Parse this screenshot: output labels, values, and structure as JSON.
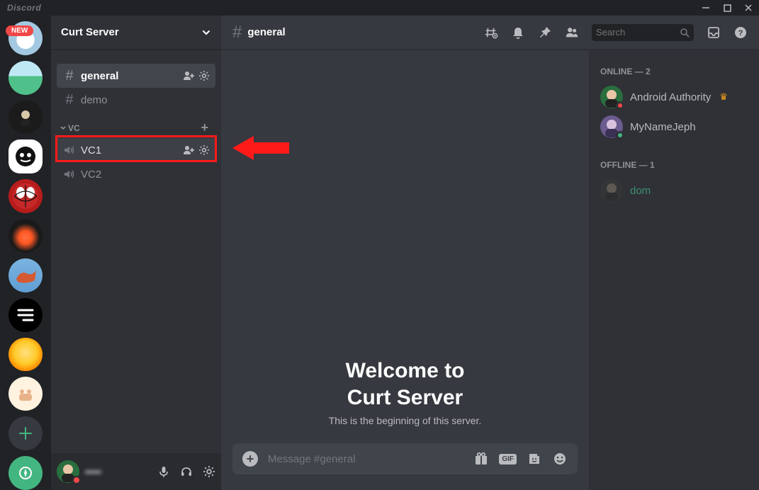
{
  "app": {
    "title": "Discord",
    "new_badge": "NEW"
  },
  "titlebar": {
    "minimize": "—",
    "maximize": "▢",
    "close": "✕"
  },
  "server": {
    "name": "Curt Server",
    "chevron": "˅"
  },
  "channels": {
    "text": [
      {
        "name": "general",
        "selected": true
      },
      {
        "name": "demo",
        "selected": false
      }
    ],
    "category": {
      "name": "VC",
      "collapsed": false
    },
    "voice": [
      {
        "name": "VC1",
        "highlighted": true
      },
      {
        "name": "VC2",
        "highlighted": false
      }
    ]
  },
  "user_footer": {
    "name": "•••••",
    "mic": "mic",
    "headset": "headset",
    "settings": "settings"
  },
  "header": {
    "channel": "general",
    "search_placeholder": "Search"
  },
  "welcome": {
    "line1": "Welcome to",
    "line2": "Curt Server",
    "sub": "This is the beginning of this server."
  },
  "chat_input": {
    "placeholder": "Message #general",
    "gif": "GIF"
  },
  "members": {
    "online_header": "ONLINE — 2",
    "offline_header": "OFFLINE — 1",
    "online": [
      {
        "name": "Android Authority",
        "status": "dnd",
        "owner": true,
        "color": "#2a6e3f"
      },
      {
        "name": "MyNameJeph",
        "status": "online",
        "owner": false,
        "color": "#6b5b8e"
      }
    ],
    "offline": [
      {
        "name": "dom",
        "status": "offline",
        "owner": false,
        "color": "#3a3a3a",
        "name_color": "#3d8f6f"
      }
    ]
  }
}
